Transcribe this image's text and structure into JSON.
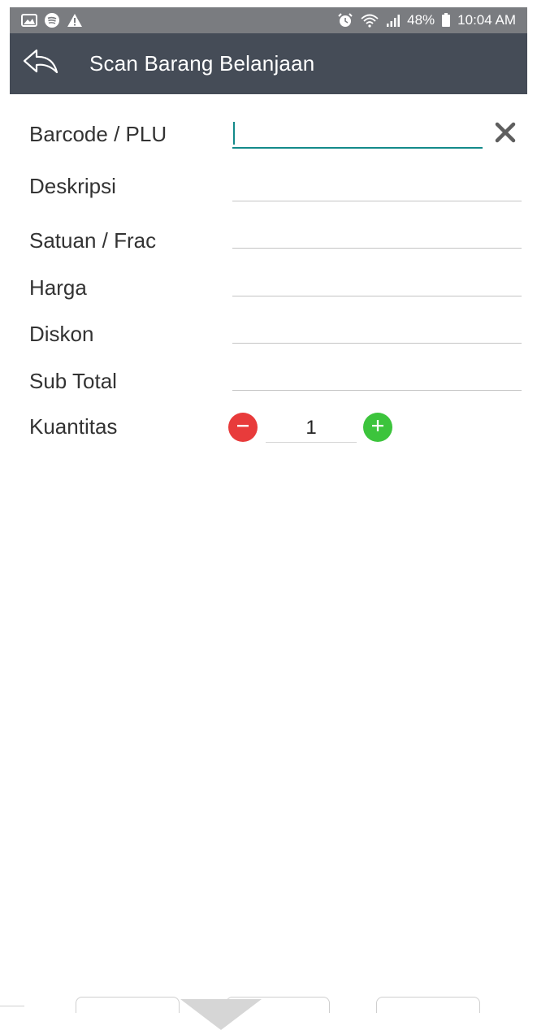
{
  "status_bar": {
    "left_icons": [
      "image-icon",
      "spotify-icon",
      "warning-icon"
    ],
    "right_icons": [
      "alarm-icon",
      "wifi-icon",
      "signal-icon"
    ],
    "battery_text": "48%",
    "time": "10:04 AM"
  },
  "app_bar": {
    "title": "Scan Barang Belanjaan",
    "back_icon": "back-arrow-icon"
  },
  "form": {
    "barcode_label": "Barcode / PLU",
    "barcode_value": "",
    "description_label": "Deskripsi",
    "description_value": "",
    "unit_label": "Satuan / Frac",
    "unit_value": "",
    "price_label": "Harga",
    "price_value": "",
    "discount_label": "Diskon",
    "discount_value": "",
    "subtotal_label": "Sub Total",
    "subtotal_value": "",
    "quantity_label": "Kuantitas",
    "quantity_value": "1"
  },
  "colors": {
    "app_bar": "#454c57",
    "status_bar": "#7a7c80",
    "accent": "#138a8a",
    "minus": "#e83b3b",
    "plus": "#3cc43c"
  }
}
